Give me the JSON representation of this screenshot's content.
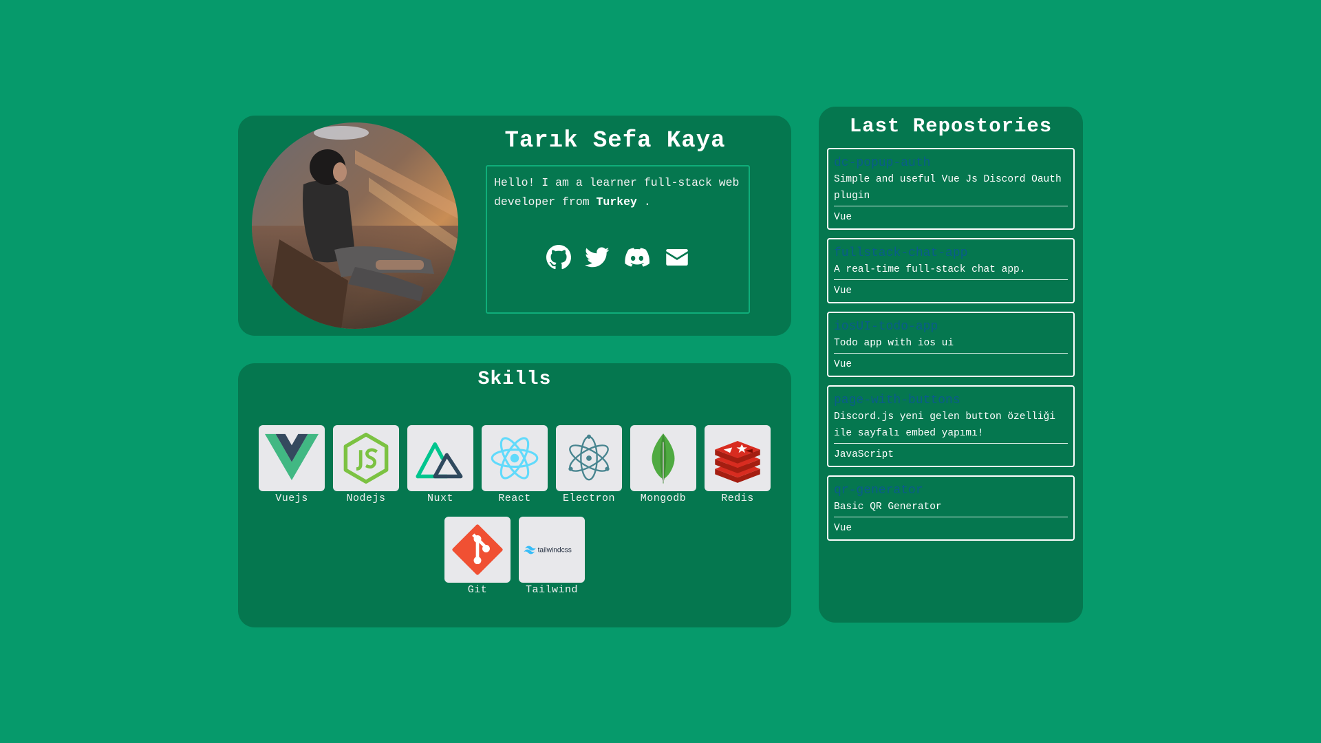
{
  "profile": {
    "name": "Tarık Sefa Kaya",
    "bio_prefix": "Hello! I am a learner full-stack web developer from ",
    "bio_country": "Turkey",
    "bio_suffix": " .",
    "socials": [
      "github-icon",
      "twitter-icon",
      "discord-icon",
      "mail-icon"
    ]
  },
  "skills": {
    "title": "Skills",
    "items": [
      {
        "label": "Vuejs",
        "icon": "vue-icon"
      },
      {
        "label": "Nodejs",
        "icon": "nodejs-icon"
      },
      {
        "label": "Nuxt",
        "icon": "nuxt-icon"
      },
      {
        "label": "React",
        "icon": "react-icon"
      },
      {
        "label": "Electron",
        "icon": "electron-icon"
      },
      {
        "label": "Mongodb",
        "icon": "mongodb-icon"
      },
      {
        "label": "Redis",
        "icon": "redis-icon"
      },
      {
        "label": "Git",
        "icon": "git-icon"
      },
      {
        "label": "Tailwind",
        "icon": "tailwind-icon",
        "logo_text": "tailwindcss"
      }
    ]
  },
  "repos": {
    "title": "Last Repostories",
    "items": [
      {
        "name": "dc-popup-auth",
        "description": "Simple and useful Vue Js Discord Oauth plugin",
        "language": "Vue"
      },
      {
        "name": "fullstack-chat-app",
        "description": "A real-time full-stack chat app.",
        "language": "Vue"
      },
      {
        "name": "iosUI-todo-app",
        "description": "Todo app with ios ui",
        "language": "Vue"
      },
      {
        "name": "page-with-buttons",
        "description": "Discord.js yeni gelen button özelliği ile sayfalı embed yapımı!",
        "language": "JavaScript"
      },
      {
        "name": "qr-generator",
        "description": "Basic QR Generator",
        "language": "Vue"
      }
    ]
  },
  "colors": {
    "background": "#069a6b",
    "card": "#05774f",
    "repo_name": "#0a5c8a"
  }
}
